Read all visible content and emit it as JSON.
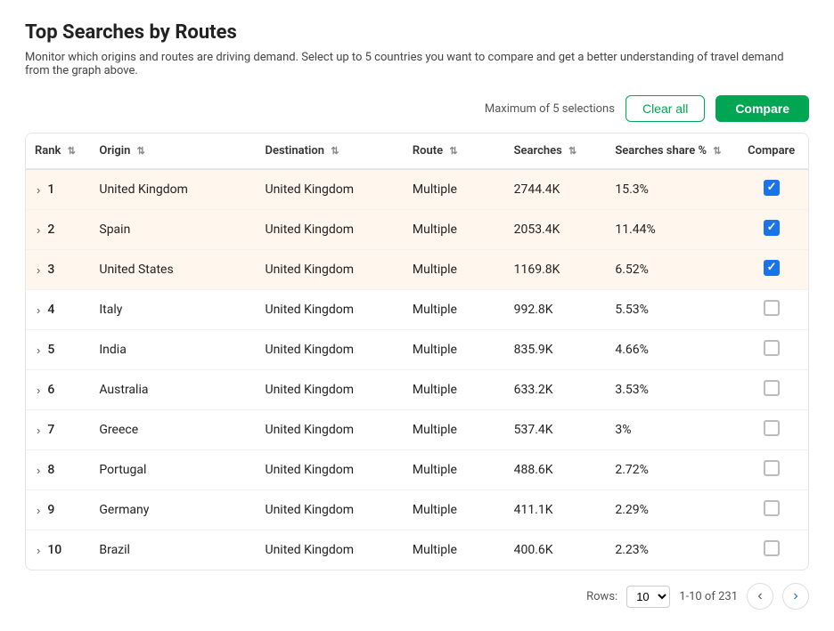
{
  "page": {
    "title": "Top Searches by Routes",
    "subtitle": "Monitor which origins and routes are driving demand. Select up to 5 countries you want to compare and get a better understanding of travel demand from the graph above."
  },
  "toolbar": {
    "max_label": "Maximum of 5 selections",
    "clear_label": "Clear all",
    "compare_label": "Compare"
  },
  "table": {
    "columns": [
      {
        "id": "rank",
        "label": "Rank"
      },
      {
        "id": "origin",
        "label": "Origin"
      },
      {
        "id": "destination",
        "label": "Destination"
      },
      {
        "id": "route",
        "label": "Route"
      },
      {
        "id": "searches",
        "label": "Searches"
      },
      {
        "id": "share",
        "label": "Searches share %"
      },
      {
        "id": "compare",
        "label": "Compare"
      }
    ],
    "rows": [
      {
        "rank": 1,
        "origin": "United Kingdom",
        "destination": "United Kingdom",
        "route": "Multiple",
        "searches": "2744.4K",
        "share": "15.3%",
        "checked": true,
        "highlighted": true
      },
      {
        "rank": 2,
        "origin": "Spain",
        "destination": "United Kingdom",
        "route": "Multiple",
        "searches": "2053.4K",
        "share": "11.44%",
        "checked": true,
        "highlighted": true
      },
      {
        "rank": 3,
        "origin": "United States",
        "destination": "United Kingdom",
        "route": "Multiple",
        "searches": "1169.8K",
        "share": "6.52%",
        "checked": true,
        "highlighted": true
      },
      {
        "rank": 4,
        "origin": "Italy",
        "destination": "United Kingdom",
        "route": "Multiple",
        "searches": "992.8K",
        "share": "5.53%",
        "checked": false,
        "highlighted": false
      },
      {
        "rank": 5,
        "origin": "India",
        "destination": "United Kingdom",
        "route": "Multiple",
        "searches": "835.9K",
        "share": "4.66%",
        "checked": false,
        "highlighted": false
      },
      {
        "rank": 6,
        "origin": "Australia",
        "destination": "United Kingdom",
        "route": "Multiple",
        "searches": "633.2K",
        "share": "3.53%",
        "checked": false,
        "highlighted": false
      },
      {
        "rank": 7,
        "origin": "Greece",
        "destination": "United Kingdom",
        "route": "Multiple",
        "searches": "537.4K",
        "share": "3%",
        "checked": false,
        "highlighted": false
      },
      {
        "rank": 8,
        "origin": "Portugal",
        "destination": "United Kingdom",
        "route": "Multiple",
        "searches": "488.6K",
        "share": "2.72%",
        "checked": false,
        "highlighted": false
      },
      {
        "rank": 9,
        "origin": "Germany",
        "destination": "United Kingdom",
        "route": "Multiple",
        "searches": "411.1K",
        "share": "2.29%",
        "checked": false,
        "highlighted": false
      },
      {
        "rank": 10,
        "origin": "Brazil",
        "destination": "United Kingdom",
        "route": "Multiple",
        "searches": "400.6K",
        "share": "2.23%",
        "checked": false,
        "highlighted": false
      }
    ]
  },
  "footer": {
    "rows_label": "Rows:",
    "rows_value": "10",
    "page_info": "1-10 of 231"
  }
}
